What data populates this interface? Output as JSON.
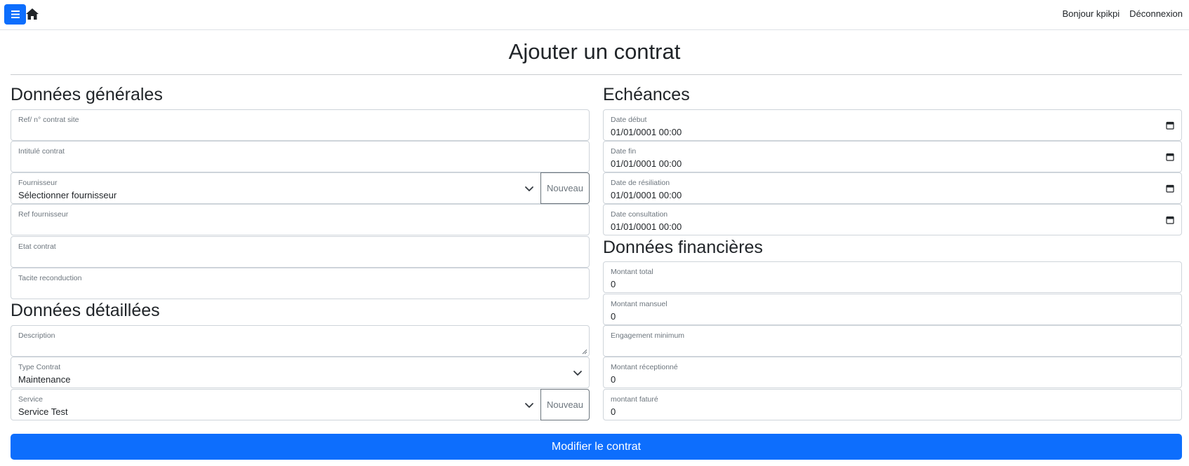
{
  "topbar": {
    "menu_icon": "hamburger-icon",
    "home_icon": "home-icon",
    "greeting": "Bonjour kpikpi",
    "logout": "Déconnexion"
  },
  "page": {
    "title": "Ajouter un contrat"
  },
  "general": {
    "title": "Données générales",
    "ref_label": "Ref/ n° contrat site",
    "ref_value": "",
    "intitule_label": "Intitulé contrat",
    "intitule_value": "",
    "fournisseur_label": "Fournisseur",
    "fournisseur_value": "Sélectionner fournisseur",
    "fournisseur_new": "Nouveau",
    "ref_fournisseur_label": "Ref fournisseur",
    "ref_fournisseur_value": "",
    "etat_label": "Etat contrat",
    "etat_value": "",
    "tacite_label": "Tacite reconduction",
    "tacite_value": ""
  },
  "details": {
    "title": "Données détaillées",
    "description_label": "Description",
    "description_value": "",
    "type_label": "Type Contrat",
    "type_value": "Maintenance",
    "service_label": "Service",
    "service_value": "Service Test",
    "service_new": "Nouveau"
  },
  "echeances": {
    "title": "Echéances",
    "date_debut_label": "Date début",
    "date_debut_value": "01/01/0001 00:00",
    "date_fin_label": "Date fin",
    "date_fin_value": "01/01/0001 00:00",
    "date_resiliation_label": "Date de résiliation",
    "date_resiliation_value": "01/01/0001 00:00",
    "date_consultation_label": "Date consultation",
    "date_consultation_value": "01/01/0001 00:00"
  },
  "finance": {
    "title": "Données financières",
    "montant_total_label": "Montant total",
    "montant_total_value": "0",
    "montant_mensuel_label": "Montant mansuel",
    "montant_mensuel_value": "0",
    "engagement_label": "Engagement minimum",
    "engagement_value": "",
    "montant_recep_label": "Montant réceptionné",
    "montant_recep_value": "0",
    "montant_facture_label": "montant faturé",
    "montant_facture_value": "0"
  },
  "submit": {
    "label": "Modifier le contrat"
  },
  "colors": {
    "primary": "#0d6efd",
    "border": "#ced4da",
    "label": "#6c757d"
  }
}
